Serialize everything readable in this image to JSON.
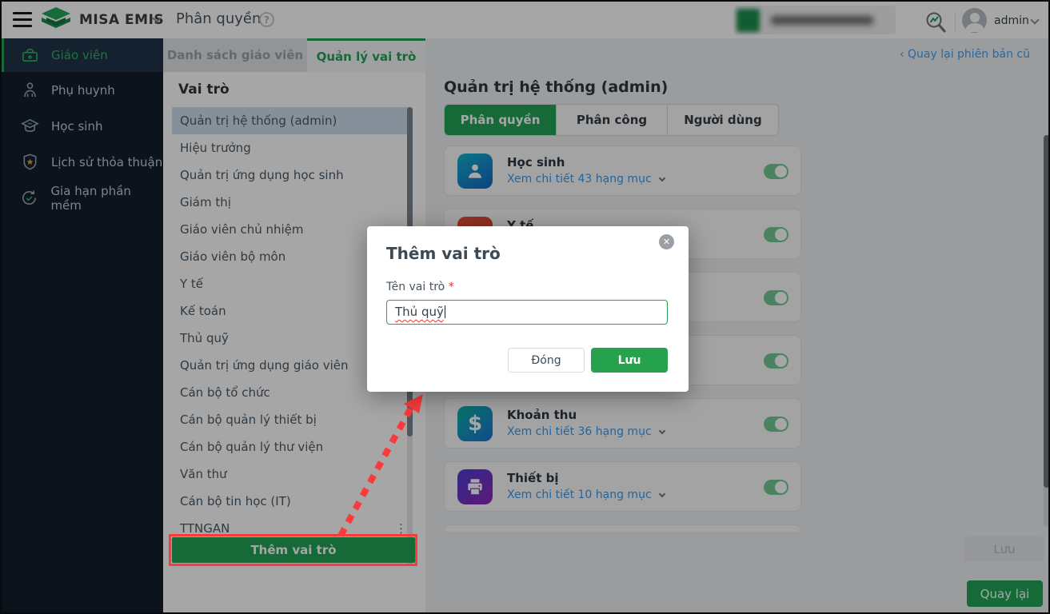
{
  "topbar": {
    "brand": "MISA EMIS",
    "page_title": "Phân quyền",
    "help": "?",
    "username": "admin"
  },
  "back_link": {
    "chevron": "‹",
    "label": "Quay lại phiên bản cũ"
  },
  "sidebar": {
    "items": [
      {
        "icon": "briefcase-icon",
        "label": "Giáo viên",
        "active": true
      },
      {
        "icon": "parent-icon",
        "label": "Phụ huynh",
        "active": false
      },
      {
        "icon": "graduation-cap-icon",
        "label": "Học sinh",
        "active": false
      },
      {
        "icon": "shield-star-icon",
        "label": "Lịch sử thỏa thuận",
        "active": false
      },
      {
        "icon": "renew-icon",
        "label": "Gia hạn phần mềm",
        "active": false
      }
    ]
  },
  "panel_tabs": {
    "list": "Danh sách giáo viên",
    "manage": "Quản lý vai trò"
  },
  "roles": {
    "title": "Vai trò",
    "items": [
      "Quản trị hệ thống (admin)",
      "Hiệu trưởng",
      "Quản trị ứng dụng học sinh",
      "Giám thị",
      "Giáo viên chủ nhiệm",
      "Giáo viên bộ môn",
      "Y tế",
      "Kế toán",
      "Thủ quỹ",
      "Quản trị ứng dụng giáo viên",
      "Cán bộ tổ chức",
      "Cán bộ quản lý thiết bị",
      "Cán bộ quản lý thư viện",
      "Văn thư",
      "Cán bộ tin học (IT)",
      "TTNGAN"
    ],
    "selected_index": 0,
    "kebab": "⋮",
    "add_button": "Thêm vai trò"
  },
  "main": {
    "heading": "Quản trị hệ thống (admin)",
    "tabs": [
      {
        "label": "Phân quyền",
        "active": true
      },
      {
        "label": "Phân công",
        "active": false
      },
      {
        "label": "Người dùng",
        "active": false
      }
    ],
    "cards": [
      {
        "icon": "student-icon",
        "label": "Học sinh",
        "detail": "Xem chi tiết 43 hạng mục",
        "toggle": true
      },
      {
        "icon": "medical-icon",
        "label": "Y tế",
        "detail": "",
        "toggle": true
      },
      {
        "icon": "hidden",
        "label": "",
        "detail": "",
        "toggle": true
      },
      {
        "icon": "hidden",
        "label": "",
        "detail": "",
        "toggle": true
      },
      {
        "icon": "money-icon",
        "label": "Khoản thu",
        "detail": "Xem chi tiết 36 hạng mục",
        "toggle": true
      },
      {
        "icon": "printer-icon",
        "label": "Thiết bị",
        "detail": "Xem chi tiết 10 hạng mục",
        "toggle": true
      }
    ],
    "footer": {
      "save": "Lưu",
      "back": "Quay lại"
    }
  },
  "modal": {
    "title": "Thêm vai trò",
    "close_icon": "✕",
    "field_label": "Tên vai trò",
    "required": "*",
    "input_value": "Thủ quỹ",
    "cancel": "Đóng",
    "save": "Lưu"
  },
  "colors": {
    "brand_green": "#21a357",
    "annotation_red": "#fb3b3b",
    "link_blue": "#3b9af0",
    "toggle_green": "#74c996"
  }
}
